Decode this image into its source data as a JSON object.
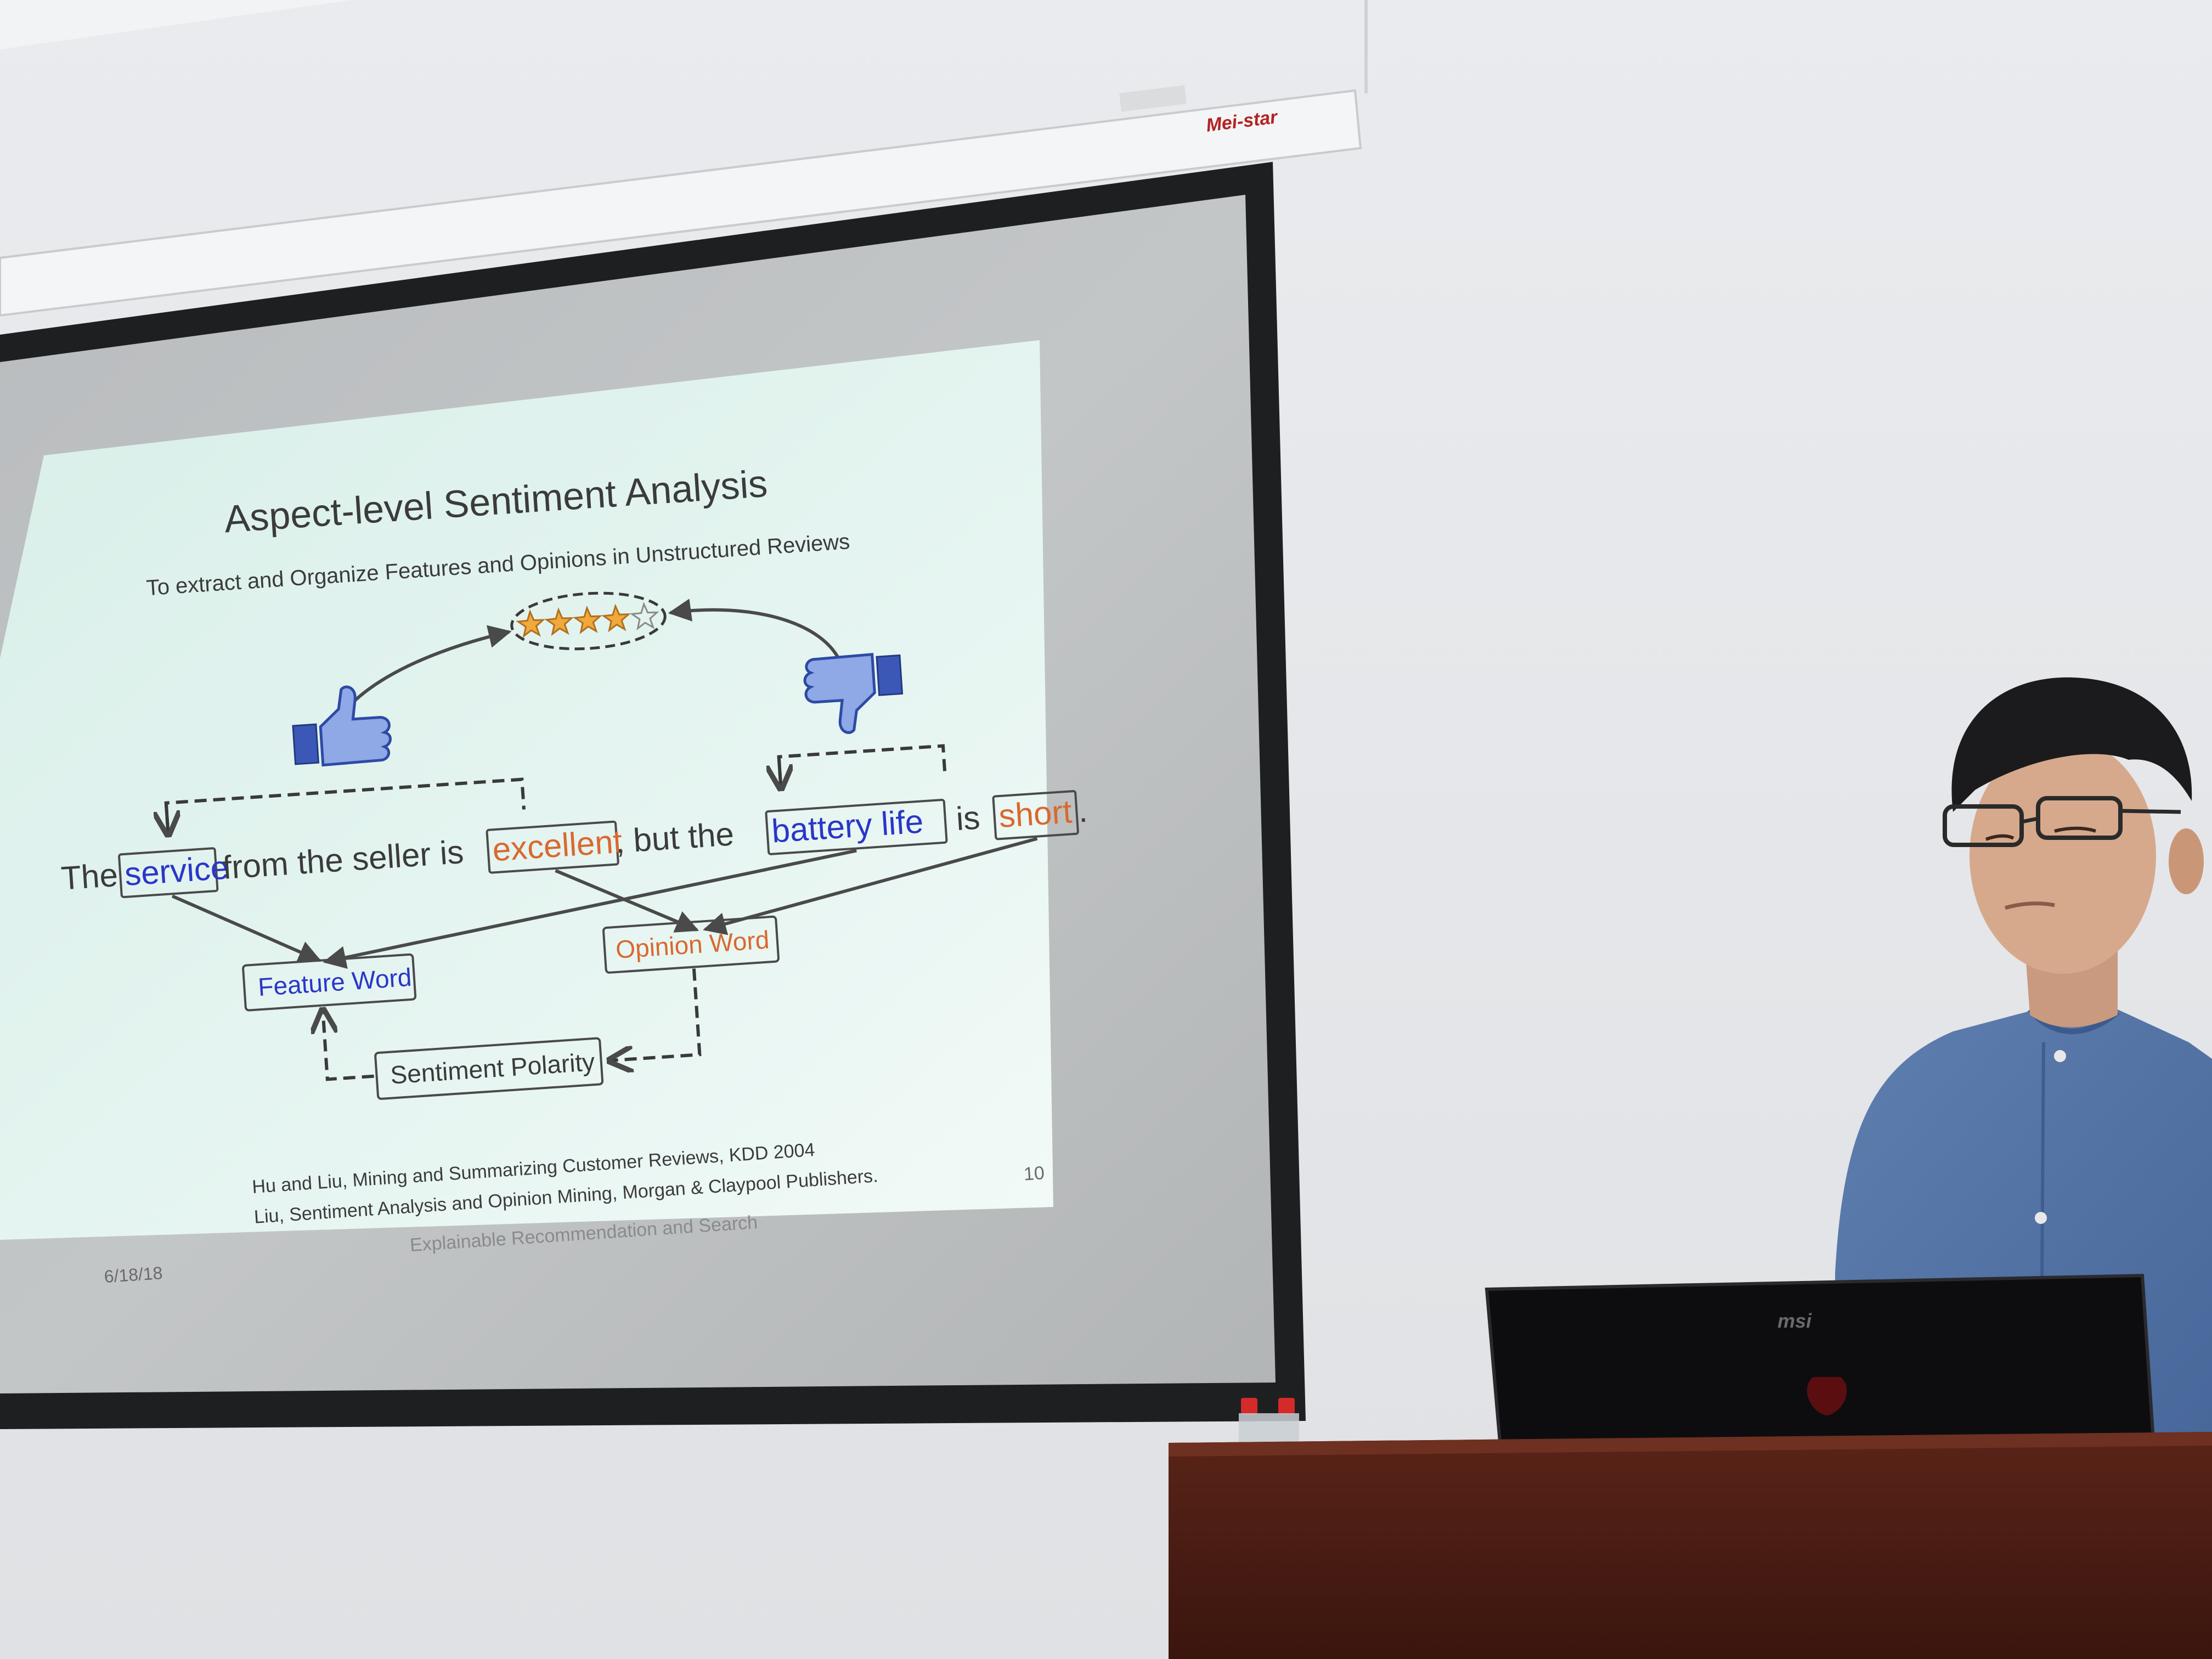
{
  "slide": {
    "title": "Aspect-level Sentiment Analysis",
    "subtitle": "To extract and Organize Features and Opinions in Unstructured Reviews",
    "sentence": {
      "the": "The",
      "service": "service",
      "from_the_seller_is": "from the seller is",
      "excellent": "excellent",
      "but_the": ", but the",
      "battery_life": "battery life",
      "is": "is",
      "short": "short",
      "period": "."
    },
    "feature_word": "Feature Word",
    "opinion_word": "Opinion Word",
    "sentiment_polarity": "Sentiment Polarity",
    "rating_stars": 4,
    "rating_max": 5,
    "reference_1": "Hu and Liu, Mining and Summarizing Customer Reviews, KDD 2004",
    "reference_2": "Liu, Sentiment Analysis and Opinion Mining, Morgan & Claypool Publishers.",
    "date": "6/18/18",
    "footer": "Explainable Recommendation and Search",
    "page_number": "10"
  },
  "screen_brand": "Mei-star",
  "laptop_brand": "msi",
  "colors": {
    "feature_blue": "#2a36c8",
    "opinion_orange": "#d9692e",
    "slide_bg": "#d7eee8",
    "star_gold": "#f0a93a"
  }
}
